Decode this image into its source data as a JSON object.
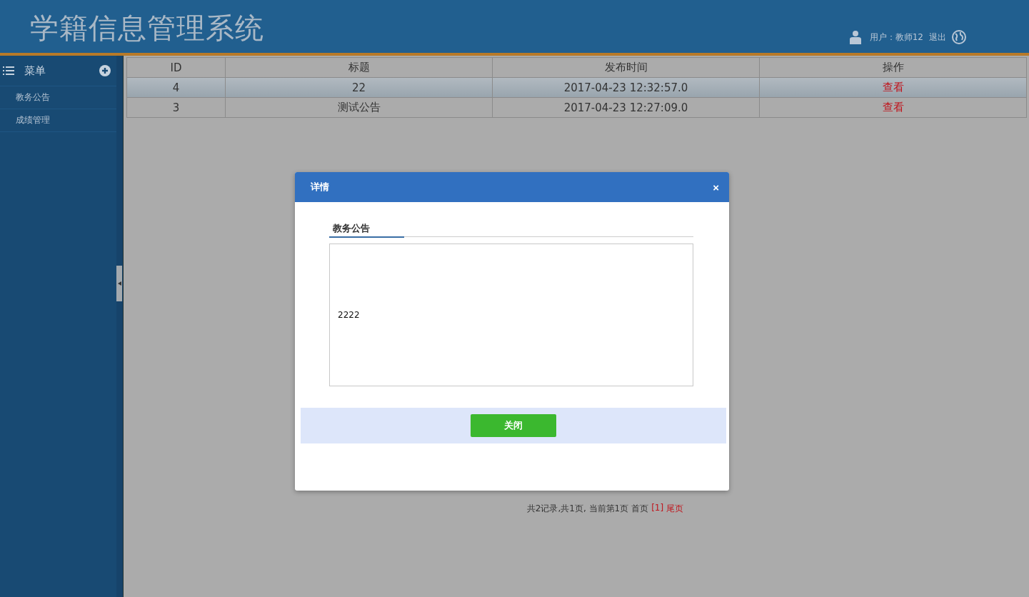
{
  "header": {
    "title": "学籍信息管理系统",
    "user": "用户：教师12",
    "logout": "退出"
  },
  "sidebar": {
    "title": "菜单",
    "items": [
      {
        "label": "教务公告"
      },
      {
        "label": "成绩管理"
      }
    ]
  },
  "table": {
    "columns": [
      "ID",
      "标题",
      "发布时间",
      "操作"
    ],
    "rows": [
      {
        "id": "4",
        "title": "22",
        "time": "2017-04-23 12:32:57.0",
        "action": "查看",
        "selected": true
      },
      {
        "id": "3",
        "title": "测试公告",
        "time": "2017-04-23 12:27:09.0",
        "action": "查看",
        "selected": false
      }
    ]
  },
  "pagination": {
    "summary": "共2记录,共1页, 当前第1页",
    "links": [
      {
        "text": "首页",
        "color": "#333333"
      },
      {
        "text": "[1]",
        "color": "#c0141c"
      },
      {
        "text": "尾页",
        "color": "#c0141c"
      }
    ]
  },
  "dialog": {
    "title": "详情",
    "close_glyph": "×",
    "tab": "教务公告",
    "content": "2222",
    "button": "关闭"
  }
}
